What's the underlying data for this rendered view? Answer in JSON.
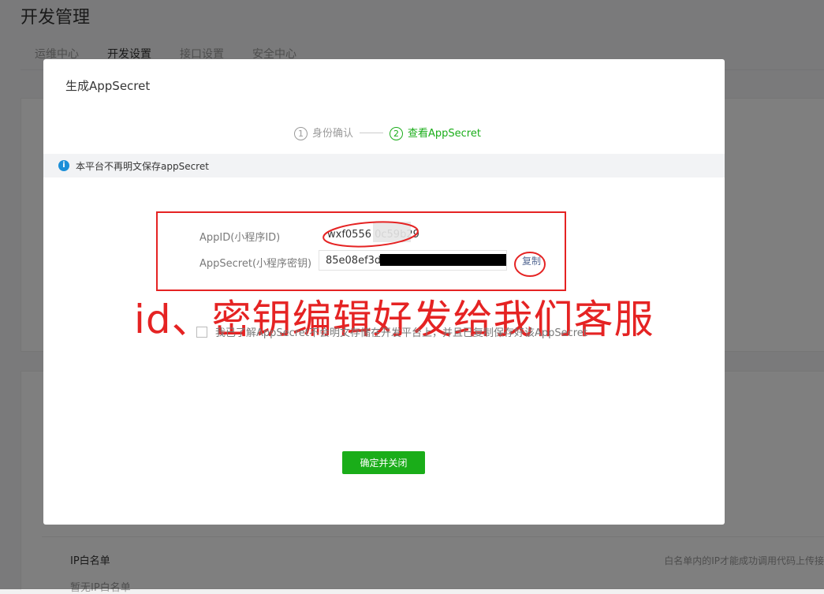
{
  "page": {
    "title": "开发管理",
    "tabs": [
      {
        "label": "运维中心"
      },
      {
        "label": "开发设置"
      },
      {
        "label": "接口设置"
      },
      {
        "label": "安全中心"
      }
    ],
    "ip_whitelist": {
      "title": "IP白名单",
      "empty": "暂无IP白名单",
      "desc": "白名单内的IP才能成功调用代码上传接"
    }
  },
  "dialog": {
    "title": "生成AppSecret",
    "steps": [
      {
        "num": "1",
        "label": "身份确认"
      },
      {
        "num": "2",
        "label": "查看AppSecret"
      }
    ],
    "notice": "本平台不再明文保存appSecret",
    "appid_label": "AppID(小程序ID)",
    "appid_value": "wxf0556    0c59b29",
    "secret_label": "AppSecret(小程序密钥)",
    "secret_value": "85e08ef3d7                              e1",
    "copy_label": "复制",
    "checkbox_label": "我已了解AppSecret不会明文存储在开发平台上，并且已复制保存好该AppSecret",
    "confirm_label": "确定并关闭",
    "annotation": "id、密钥编辑好发给我们客服"
  },
  "colors": {
    "accent_green": "#1aad19",
    "annotation_red": "#e52323",
    "info_blue": "#1c8fd8"
  }
}
